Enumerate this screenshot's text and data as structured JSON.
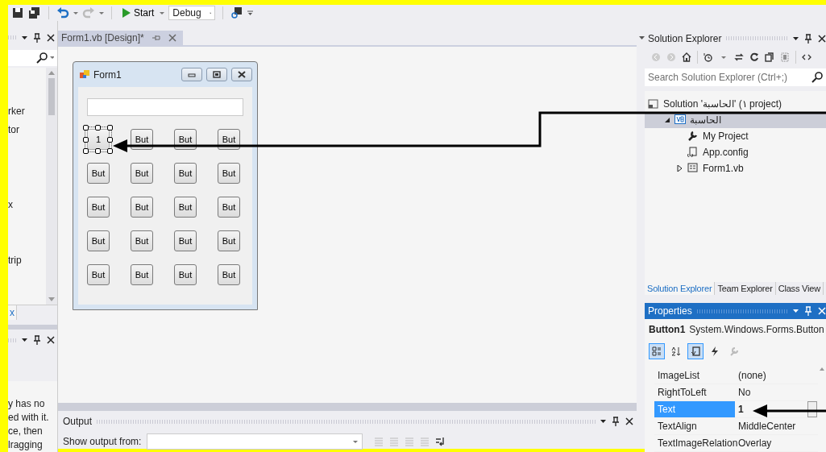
{
  "toolbar": {
    "start_label": "Start",
    "configuration": "Debug"
  },
  "left_panel": {
    "list_items": [
      "rker",
      "tor",
      "x",
      "trip"
    ],
    "tab_label": "x",
    "description_lines": [
      "y has no",
      "ed with it.",
      "ce, then",
      "lragging"
    ]
  },
  "document_tab": {
    "title": "Form1.vb [Design]*",
    "selected": true
  },
  "form": {
    "title": "Form1",
    "buttons": [
      {
        "label": "1",
        "selected": true
      },
      {
        "label": "But",
        "selected": false
      },
      {
        "label": "But",
        "selected": false
      },
      {
        "label": "But",
        "selected": false
      },
      {
        "label": "But",
        "selected": false
      },
      {
        "label": "But",
        "selected": false
      },
      {
        "label": "But",
        "selected": false
      },
      {
        "label": "But",
        "selected": false
      },
      {
        "label": "But",
        "selected": false
      },
      {
        "label": "But",
        "selected": false
      },
      {
        "label": "But",
        "selected": false
      },
      {
        "label": "But",
        "selected": false
      },
      {
        "label": "But",
        "selected": false
      },
      {
        "label": "But",
        "selected": false
      },
      {
        "label": "But",
        "selected": false
      },
      {
        "label": "But",
        "selected": false
      },
      {
        "label": "But",
        "selected": false
      },
      {
        "label": "But",
        "selected": false
      },
      {
        "label": "But",
        "selected": false
      },
      {
        "label": "But",
        "selected": false
      }
    ]
  },
  "output": {
    "title": "Output",
    "show_from_label": "Show output from:"
  },
  "solution_explorer": {
    "title": "Solution Explorer",
    "search_placeholder": "Search Solution Explorer (Ctrl+;)",
    "tree": [
      {
        "label": "Solution 'الحاسبة' (١ project)",
        "kind": "solution",
        "selected": false,
        "children": [
          {
            "label": "الحاسبة",
            "kind": "project",
            "selected": true,
            "expanded": true,
            "children": [
              {
                "label": "My Project",
                "kind": "settings",
                "selected": false
              },
              {
                "label": "App.config",
                "kind": "config",
                "selected": false
              },
              {
                "label": "Form1.vb",
                "kind": "form",
                "selected": false,
                "expanded": false
              }
            ]
          }
        ]
      }
    ]
  },
  "bottom_tabs": [
    {
      "label": "Solution Explorer",
      "selected": true
    },
    {
      "label": "Team Explorer",
      "selected": false
    },
    {
      "label": "Class View",
      "selected": false
    }
  ],
  "properties": {
    "title": "Properties",
    "object_name": "Button1",
    "object_type": "System.Windows.Forms.Button",
    "rows": [
      {
        "name": "ImageList",
        "value": "(none)",
        "selected": false,
        "modified": false
      },
      {
        "name": "RightToLeft",
        "value": "No",
        "selected": false,
        "modified": false
      },
      {
        "name": "Text",
        "value": "1",
        "selected": true,
        "modified": true
      },
      {
        "name": "TextAlign",
        "value": "MiddleCenter",
        "selected": false,
        "modified": false
      },
      {
        "name": "TextImageRelation",
        "value": "Overlay",
        "selected": false,
        "modified": false
      }
    ]
  }
}
